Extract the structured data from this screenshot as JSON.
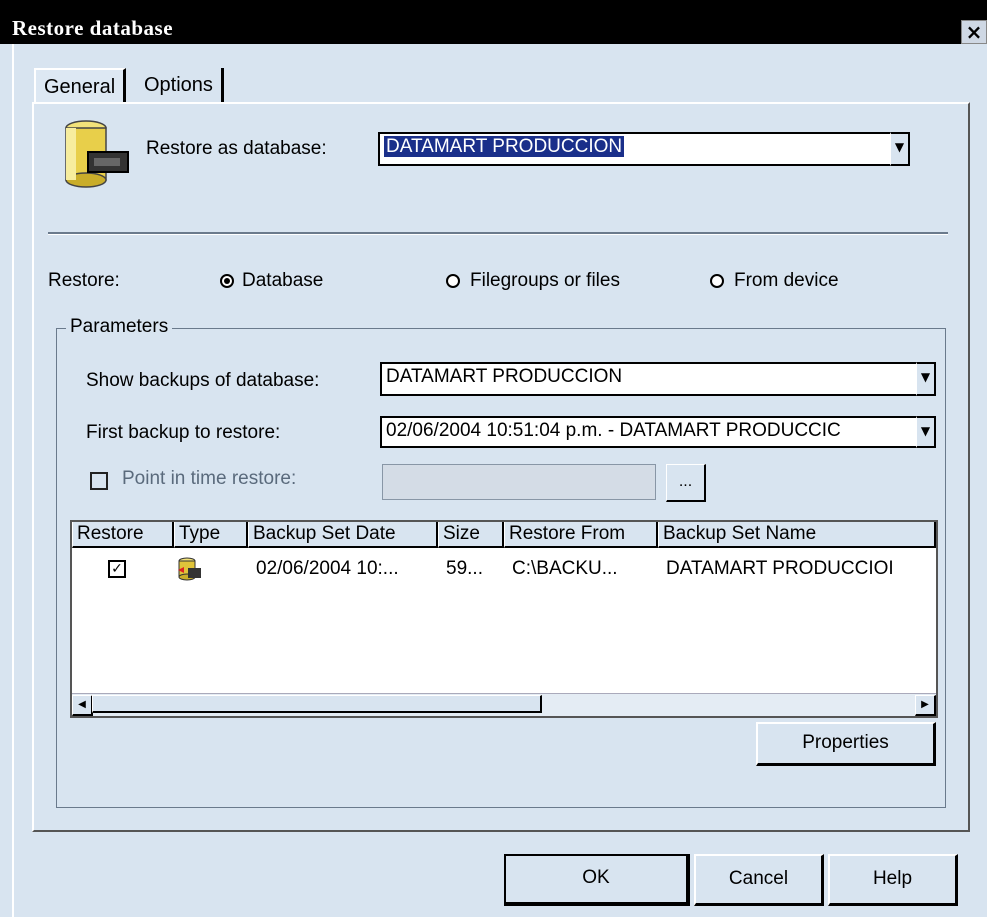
{
  "window": {
    "title": "Restore database",
    "close_glyph": "×"
  },
  "tabs": [
    {
      "label": "General"
    },
    {
      "label": "Options"
    }
  ],
  "restore_as": {
    "label": "Restore as database:",
    "value": "DATAMART PRODUCCION"
  },
  "restore": {
    "label": "Restore:",
    "options": [
      {
        "label": "Database",
        "selected": true
      },
      {
        "label": "Filegroups or files",
        "selected": false
      },
      {
        "label": "From device",
        "selected": false
      }
    ]
  },
  "parameters": {
    "title": "Parameters",
    "show_backups_label": "Show backups of database:",
    "show_backups_value": "DATAMART PRODUCCION",
    "first_backup_label": "First backup to restore:",
    "first_backup_value": "02/06/2004 10:51:04 p.m. - DATAMART PRODUCCIC",
    "point_in_time_label": "Point in time restore:",
    "ellipsis": "..."
  },
  "grid": {
    "columns": [
      "Restore",
      "Type",
      "Backup Set Date",
      "Size",
      "Restore From",
      "Backup Set Name"
    ],
    "rows": [
      {
        "restore_check": "✓",
        "type_icon": "database-backup-icon",
        "date": "02/06/2004 10:...",
        "size": "59...",
        "from": "C:\\BACKU...",
        "name": "DATAMART PRODUCCIOI"
      }
    ]
  },
  "buttons": {
    "properties": "Properties",
    "ok": "OK",
    "cancel": "Cancel",
    "help": "Help"
  },
  "colors": {
    "titlebar": "#000000",
    "dialog_bg": "#d8e4f0",
    "selection": "#1a2f8a"
  }
}
